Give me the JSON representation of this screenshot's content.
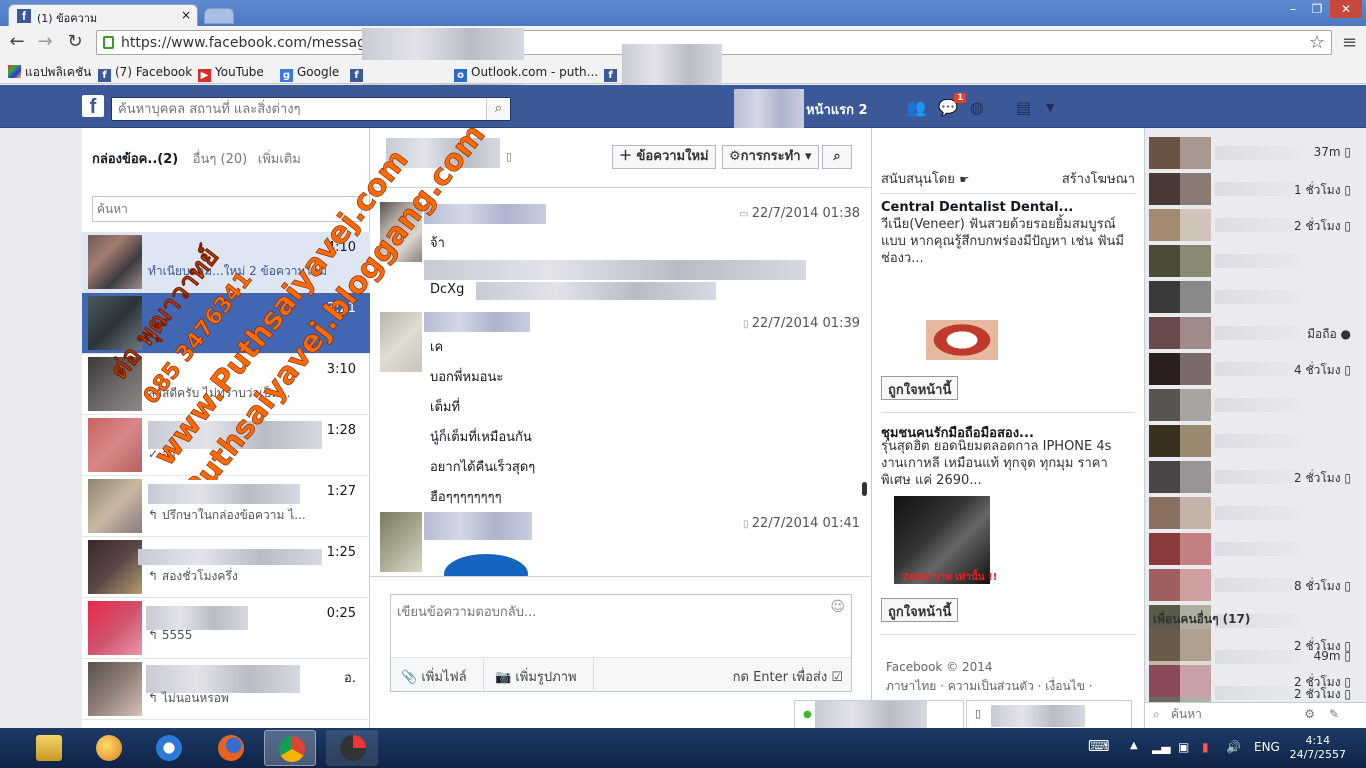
{
  "browser": {
    "tab_title": "(1) ข้อความ",
    "url": "https://www.facebook.com/messages",
    "bookmarks": [
      "แอปพลิเคชัน",
      "(7) Facebook",
      "YouTube",
      "Google",
      "Outlook.com - puth..."
    ]
  },
  "fb": {
    "search_placeholder": "ค้นหาบุคคล สถานที่ และสิ่งต่างๆ",
    "home": "หน้าแรก 2",
    "notif_count": "1"
  },
  "inbox": {
    "heading_main": "กล่องข้อค..",
    "heading_count": "(2)",
    "heading_other": "อื่นๆ (20)",
    "heading_more": "เพิ่มเติม",
    "search_placeholder": "ค้นหา",
    "threads": [
      {
        "time": "4:10",
        "snippet": "ทำเนียบกลุ่ม...ใหม่ 2 ข้อความใหม่"
      },
      {
        "time": "3:21",
        "snippet": ""
      },
      {
        "time": "3:10",
        "snippet": "สวัสดีครับ ไม่ทราบว่าเป็น..."
      },
      {
        "time": "1:28",
        "snippet": "✓ จ้า"
      },
      {
        "time": "1:27",
        "snippet": "↰ ปรึกษาในกล่องข้อความ ไ..."
      },
      {
        "time": "1:25",
        "snippet": "↰ สองชั่วโมงครึ่ง"
      },
      {
        "time": "0:25",
        "snippet": "↰ 5555"
      },
      {
        "time": "อ.",
        "snippet": "↰ ไม่นอนหรอพ"
      }
    ]
  },
  "conversation": {
    "new_message": "ข้อความใหม่",
    "actions": "การกระทำ",
    "messages": [
      {
        "ts": "22/7/2014 01:38",
        "lines": [
          "จ้า",
          "DcXg"
        ]
      },
      {
        "ts": "22/7/2014 01:39",
        "lines": [
          "เค",
          "บอกพี่หมอนะ",
          "เต็มที่",
          "นู๋ก็เต็มที่เหมือนกัน",
          "อยากได้คืนเร็วสุดๆ",
          "ฮือๆๆๆๆๆๆๆๆ"
        ]
      },
      {
        "ts": "22/7/2014 01:41",
        "lines": []
      }
    ],
    "reply_placeholder": "เขียนข้อความตอบกลับ...",
    "add_file": "เพิ่มไฟล์",
    "add_photo": "เพิ่มรูปภาพ",
    "enter_to_send": "กด Enter เพื่อส่ง"
  },
  "ads": {
    "sponsored": "สนับสนุนโดย",
    "create_ad": "สร้างโฆษณา",
    "ad1_title": "Central Dentalist Dental...",
    "ad1_body": "วีเนีย(Veneer) ฟันสวยด้วยรอยยิ้มสมบูรณ์แบบ หากคุณรู้สึกบกพร่องมีปัญหา เช่น ฟันมีช่องว...",
    "ad2_title": "ชุมชนคนรักมือถือมือสอง...",
    "ad2_body": "รุ่นสุดฮิต ยอดนิยมตลอดกาล IPHONE 4s งานเกาหลี เหมือนแท้ ทุกจุด ทุกมุม ราคาพิเศษ แค่ 2690...",
    "ad2_price": "2690 บาท เท่านั้น !!",
    "like_page": "ถูกใจหน้านี้",
    "footer_copy": "Facebook © 2014",
    "footer_links": "ภาษาไทย · ความเป็นส่วนตัว · เงื่อนไข ·"
  },
  "chat": {
    "friends": [
      "37m",
      "1 ชั่วโมง",
      "2 ชั่วโมง",
      "",
      "",
      "มือถือ",
      "4 ชั่วโมง",
      "",
      "",
      "2 ชั่วโมง",
      "",
      "",
      "8 ชั่วโมง",
      "",
      "49m",
      "2 ชั่วโมง"
    ],
    "more_friends": "เพื่อนคนอื่นๆ (17)",
    "more_friends_times": [
      "2 ชั่วโมง",
      "2 ชั่วโมง"
    ],
    "search_placeholder": "ค้นหา"
  },
  "watermark": {
    "line1": "ต่อ พุฒาวาทย์",
    "line2": "085 3476341",
    "line3": "www.Puthsaiyavej.com",
    "line4": "Puthsaiyavej.bloggang.com"
  },
  "taskbar": {
    "lang": "ENG",
    "time": "4:14",
    "date": "24/7/2557"
  },
  "colors": {
    "fb_blue": "#3b5998",
    "selected_thread": "#4267b2",
    "watermark_orange": "#ff6a00"
  }
}
